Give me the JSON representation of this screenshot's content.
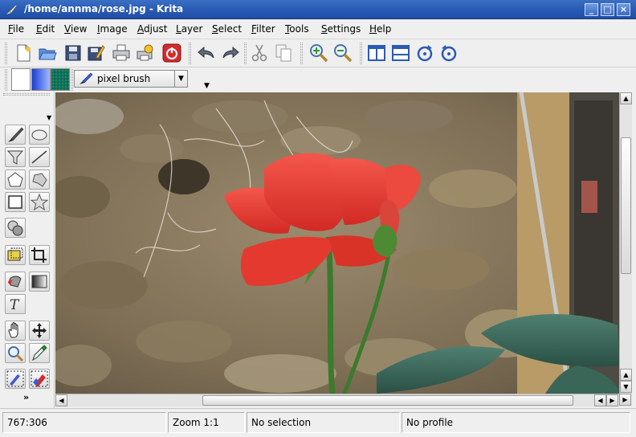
{
  "window": {
    "title": "/home/annma/rose.jpg - Krita"
  },
  "menu": {
    "items": [
      {
        "label": "File",
        "ul": "F"
      },
      {
        "label": "Edit",
        "ul": "E"
      },
      {
        "label": "View",
        "ul": "V"
      },
      {
        "label": "Image",
        "ul": "I"
      },
      {
        "label": "Adjust",
        "ul": "A"
      },
      {
        "label": "Layer",
        "ul": "L"
      },
      {
        "label": "Select",
        "ul": "S"
      },
      {
        "label": "Filter",
        "ul": "F"
      },
      {
        "label": "Tools",
        "ul": "T"
      },
      {
        "label": "Settings",
        "ul": "S"
      },
      {
        "label": "Help",
        "ul": "H"
      }
    ]
  },
  "toolbar": {
    "icons": [
      "new-icon",
      "open-icon",
      "save-icon",
      "save-as-icon",
      "print-icon",
      "print-preview-icon",
      "quit-icon",
      "undo-icon",
      "redo-icon",
      "cut-icon",
      "copy-icon",
      "zoom-in-icon",
      "zoom-out-icon",
      "split-vertical-icon",
      "split-horizontal-icon",
      "rotate-cw-icon",
      "rotate-ccw-icon"
    ]
  },
  "brushbar": {
    "brush_label": "pixel brush",
    "fg_color": "#ffffff",
    "gradient_colors": [
      "#1a3fd6",
      "#9fb8ff"
    ],
    "pattern_color": "#0e6b55"
  },
  "status": {
    "coords": "767:306",
    "zoom": "Zoom 1:1",
    "selection": "No selection",
    "profile": "No profile"
  }
}
